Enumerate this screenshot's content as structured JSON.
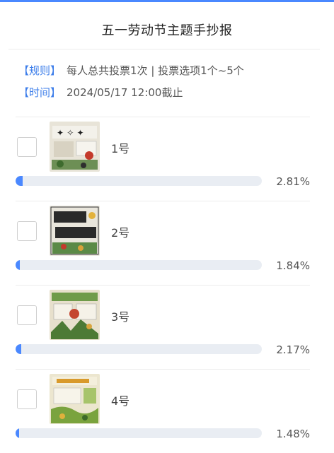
{
  "header": {
    "title": "五一劳动节主题手抄报"
  },
  "info": {
    "rule_tag": "【规则】",
    "rule_text": "每人总共投票1次 | 投票选项1个~5个",
    "time_tag": "【时间】",
    "time_text": "2024/05/17 12:00截止"
  },
  "options": [
    {
      "label": "1号",
      "percent_text": "2.81%",
      "percent": 2.81,
      "thumb_icon": "poster-thumbnail-icon"
    },
    {
      "label": "2号",
      "percent_text": "1.84%",
      "percent": 1.84,
      "thumb_icon": "poster-thumbnail-icon"
    },
    {
      "label": "3号",
      "percent_text": "2.17%",
      "percent": 2.17,
      "thumb_icon": "poster-thumbnail-icon"
    },
    {
      "label": "4号",
      "percent_text": "1.48%",
      "percent": 1.48,
      "thumb_icon": "poster-thumbnail-icon"
    }
  ],
  "colors": {
    "accent": "#4a88ff",
    "tag": "#3d7eea",
    "bar_bg": "#e9edf3"
  }
}
